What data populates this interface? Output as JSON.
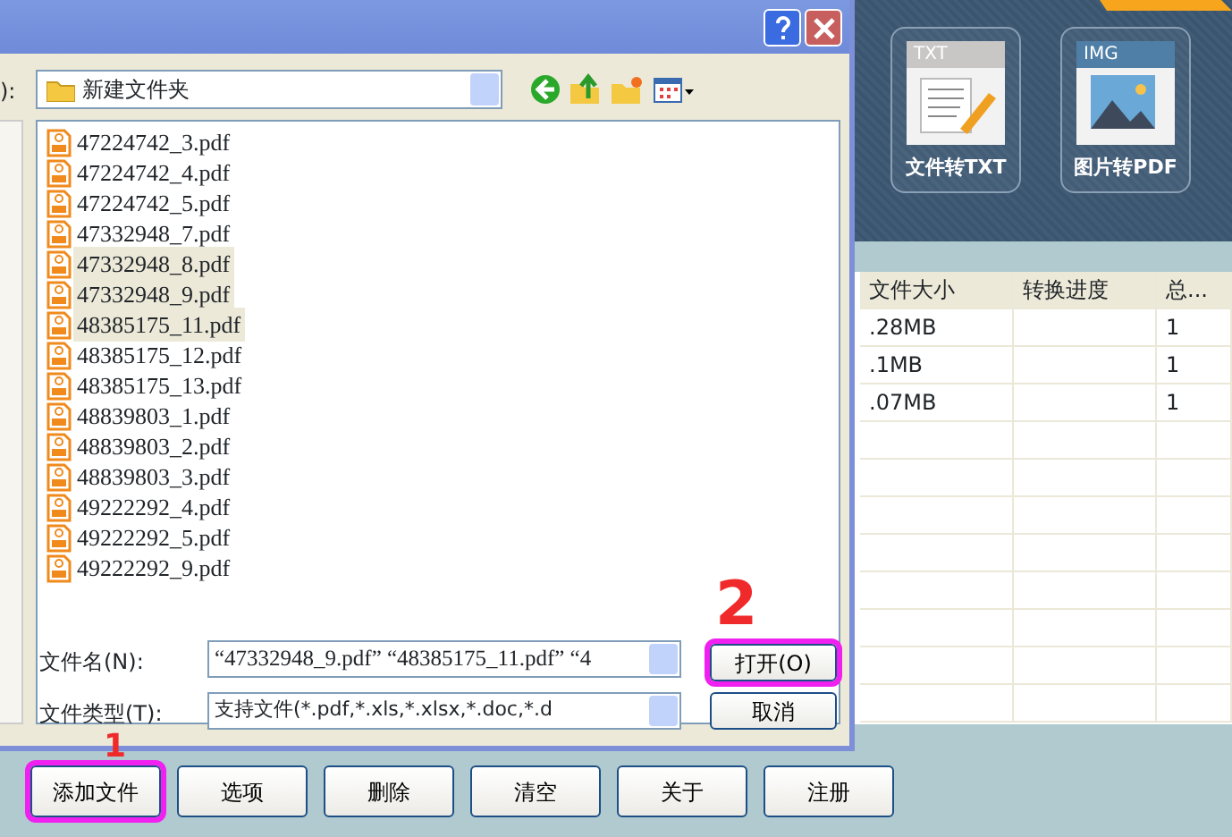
{
  "app": {
    "tools": [
      {
        "kind": "txt",
        "badge": "TXT",
        "label": "文件转TXT"
      },
      {
        "kind": "img",
        "badge": "IMG",
        "label": "图片转PDF"
      }
    ],
    "table": {
      "columns": [
        "文件大小",
        "转换进度",
        "总..."
      ],
      "rows": [
        {
          "size": ".28MB",
          "total": "1"
        },
        {
          "size": ".1MB",
          "total": "1"
        },
        {
          "size": ".07MB",
          "total": "1"
        }
      ]
    },
    "buttons": [
      {
        "label": "添加文件",
        "highlighted": true
      },
      {
        "label": "选项",
        "highlighted": false
      },
      {
        "label": "删除",
        "highlighted": false
      },
      {
        "label": "清空",
        "highlighted": false
      },
      {
        "label": "关于",
        "highlighted": false
      },
      {
        "label": "注册",
        "highlighted": false
      }
    ],
    "annotation": "1"
  },
  "dialog": {
    "look_in_label": "):",
    "folder": "新建文件夹",
    "files": [
      {
        "name": "47224742_3.pdf",
        "selected": false
      },
      {
        "name": "47224742_4.pdf",
        "selected": false
      },
      {
        "name": "47224742_5.pdf",
        "selected": false
      },
      {
        "name": "47332948_7.pdf",
        "selected": false
      },
      {
        "name": "47332948_8.pdf",
        "selected": true
      },
      {
        "name": "47332948_9.pdf",
        "selected": true
      },
      {
        "name": "48385175_11.pdf",
        "selected": true
      },
      {
        "name": "48385175_12.pdf",
        "selected": false
      },
      {
        "name": "48385175_13.pdf",
        "selected": false
      },
      {
        "name": "48839803_1.pdf",
        "selected": false
      },
      {
        "name": "48839803_2.pdf",
        "selected": false
      },
      {
        "name": "48839803_3.pdf",
        "selected": false
      },
      {
        "name": "49222292_4.pdf",
        "selected": false
      },
      {
        "name": "49222292_5.pdf",
        "selected": false
      },
      {
        "name": "49222292_9.pdf",
        "selected": false
      }
    ],
    "filename_label": "文件名(N):",
    "filename_value": "“47332948_9.pdf” “48385175_11.pdf” “4",
    "filetype_label": "文件类型(T):",
    "filetype_value": "支持文件(*.pdf,*.xls,*.xlsx,*.doc,*.d",
    "open_button": {
      "label": "打开(O)",
      "highlighted": true
    },
    "cancel_button": {
      "label": "取消",
      "highlighted": false
    },
    "annotation": "2"
  }
}
